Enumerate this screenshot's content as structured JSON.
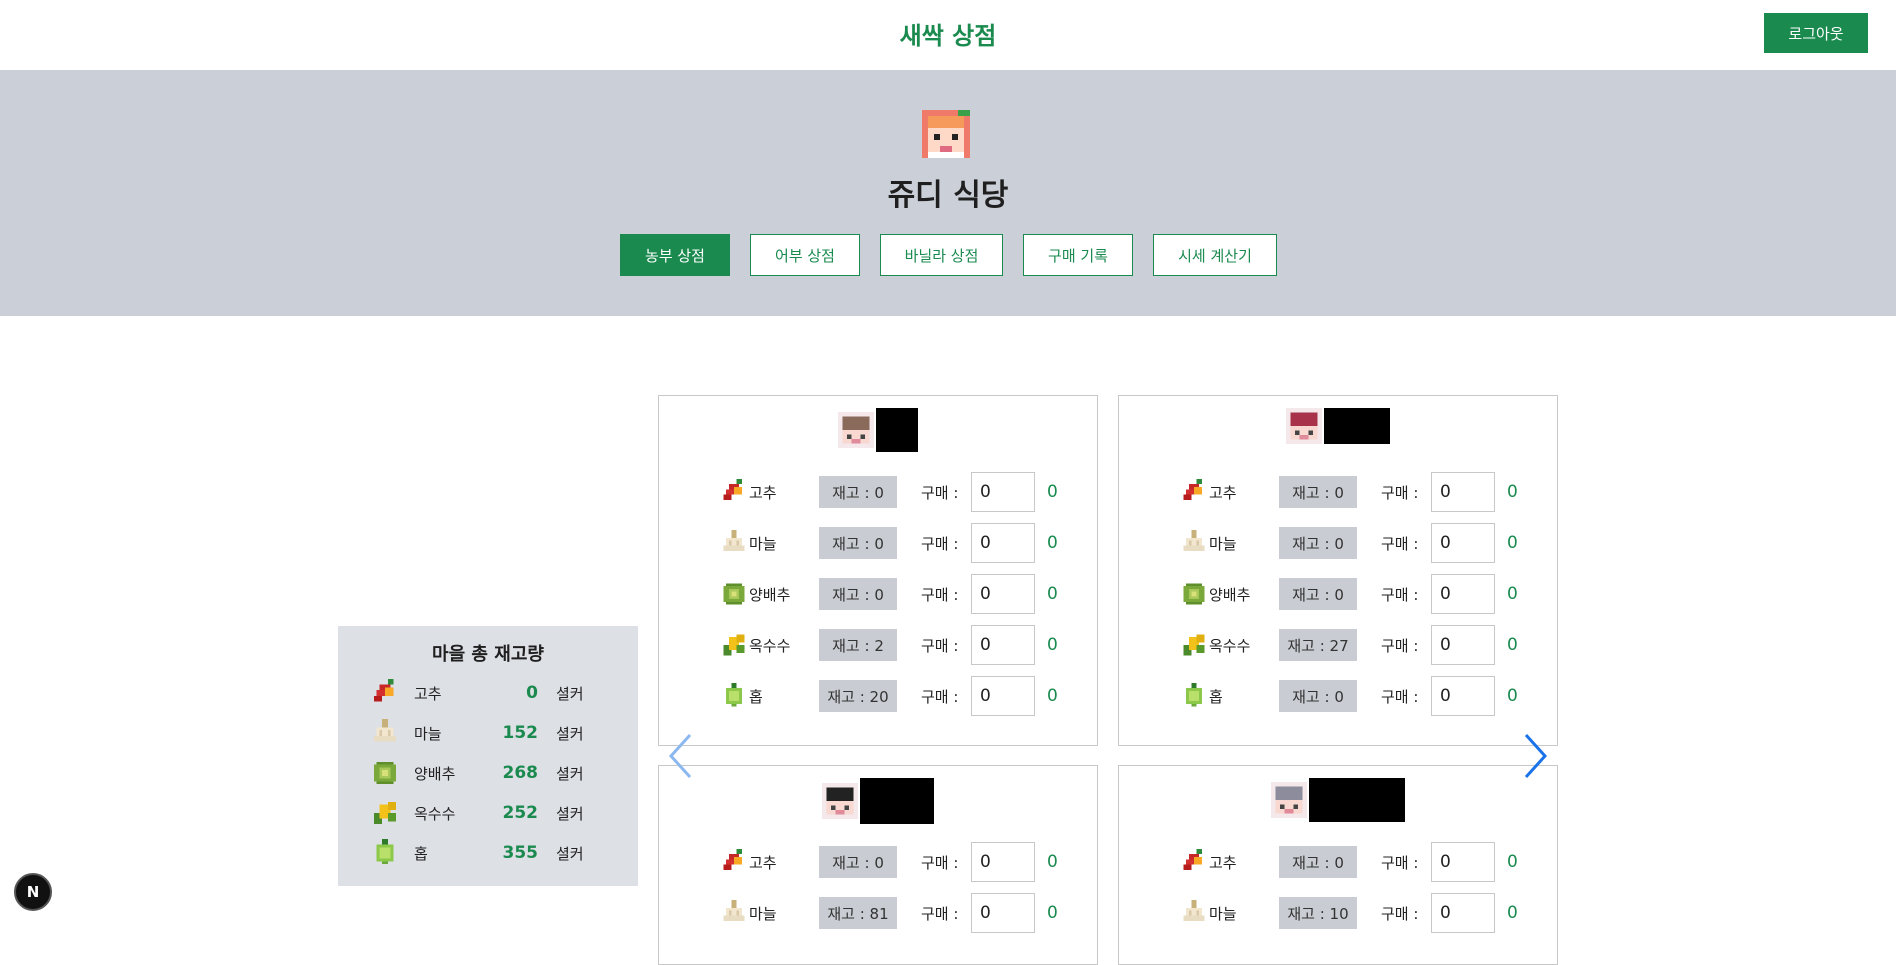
{
  "header": {
    "brand": "새싹 상점",
    "logout_label": "로그아웃"
  },
  "hero": {
    "shop_title": "쥬디 식당",
    "tabs": [
      {
        "label": "농부 상점",
        "active": true
      },
      {
        "label": "어부 상점",
        "active": false
      },
      {
        "label": "바닐라 상점",
        "active": false
      },
      {
        "label": "구매 기록",
        "active": false
      },
      {
        "label": "시세 계산기",
        "active": false
      }
    ]
  },
  "totals": {
    "title": "마을 총 재고량",
    "items": [
      {
        "name": "고추",
        "count": "0",
        "unit": "셜커",
        "icon": "pepper-icon"
      },
      {
        "name": "마늘",
        "count": "152",
        "unit": "셜커",
        "icon": "garlic-icon"
      },
      {
        "name": "양배추",
        "count": "268",
        "unit": "셜커",
        "icon": "cabbage-icon"
      },
      {
        "name": "옥수수",
        "count": "252",
        "unit": "셜커",
        "icon": "corn-icon"
      },
      {
        "name": "홉",
        "count": "355",
        "unit": "셜커",
        "icon": "hops-icon"
      }
    ]
  },
  "buy_label": "구매 :",
  "cards": [
    {
      "face_color": "#8a6a5a",
      "items": [
        {
          "name": "고추",
          "stock": "재고 : 0",
          "qty": "0",
          "cost": "0"
        },
        {
          "name": "마늘",
          "stock": "재고 : 0",
          "qty": "0",
          "cost": "0"
        },
        {
          "name": "양배추",
          "stock": "재고 : 0",
          "qty": "0",
          "cost": "0"
        },
        {
          "name": "옥수수",
          "stock": "재고 : 2",
          "qty": "0",
          "cost": "0"
        },
        {
          "name": "홉",
          "stock": "재고 : 20",
          "qty": "0",
          "cost": "0"
        }
      ]
    },
    {
      "face_color": "#a8324a",
      "items": [
        {
          "name": "고추",
          "stock": "재고 : 0",
          "qty": "0",
          "cost": "0"
        },
        {
          "name": "마늘",
          "stock": "재고 : 0",
          "qty": "0",
          "cost": "0"
        },
        {
          "name": "양배추",
          "stock": "재고 : 0",
          "qty": "0",
          "cost": "0"
        },
        {
          "name": "옥수수",
          "stock": "재고 : 27",
          "qty": "0",
          "cost": "0"
        },
        {
          "name": "홉",
          "stock": "재고 : 0",
          "qty": "0",
          "cost": "0"
        }
      ]
    },
    {
      "face_color": "#222222",
      "items": [
        {
          "name": "고추",
          "stock": "재고 : 0",
          "qty": "0",
          "cost": "0"
        },
        {
          "name": "마늘",
          "stock": "재고 : 81",
          "qty": "0",
          "cost": "0"
        }
      ]
    },
    {
      "face_color": "#8c8c9c",
      "items": [
        {
          "name": "고추",
          "stock": "재고 : 0",
          "qty": "0",
          "cost": "0"
        },
        {
          "name": "마늘",
          "stock": "재고 : 10",
          "qty": "0",
          "cost": "0"
        }
      ]
    }
  ],
  "colors": {
    "accent": "#1a8a4f",
    "hero_bg": "#cbd0d8",
    "panel_bg": "#dde0e5",
    "arrow": "#1a73e8"
  },
  "fab_label": "N"
}
